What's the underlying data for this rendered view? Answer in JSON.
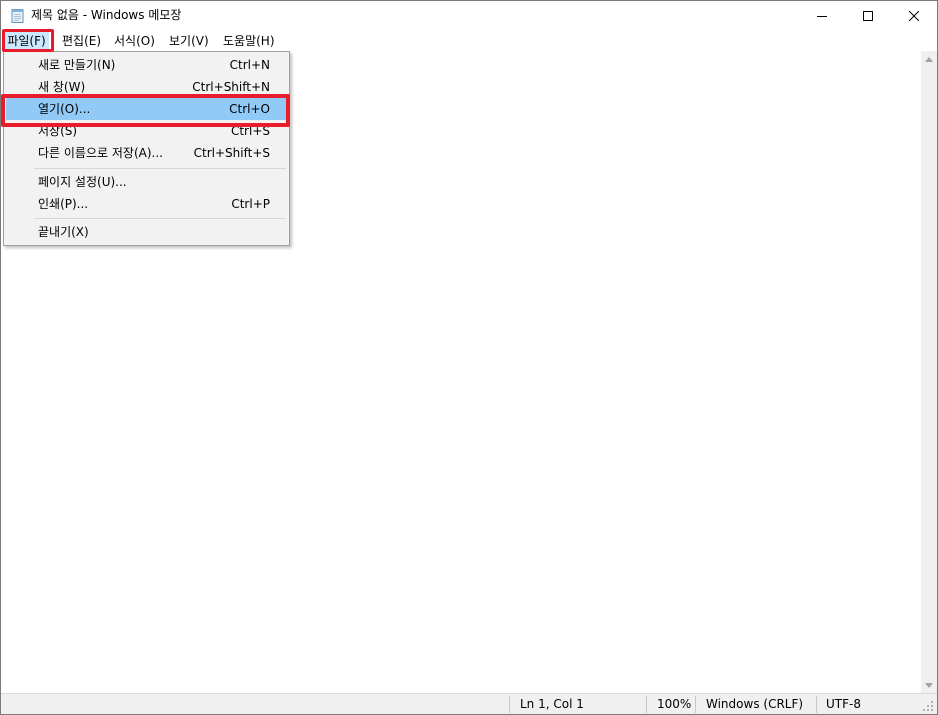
{
  "window": {
    "title": "제목 없음 - Windows 메모장",
    "icon": "notepad-icon"
  },
  "menubar": {
    "file": "파일(F)",
    "edit": "편집(E)",
    "format": "서식(O)",
    "view": "보기(V)",
    "help": "도움말(H)"
  },
  "file_menu": {
    "items": [
      {
        "label": "새로 만들기(N)",
        "shortcut": "Ctrl+N"
      },
      {
        "label": "새 창(W)",
        "shortcut": "Ctrl+Shift+N"
      },
      {
        "label": "열기(O)...",
        "shortcut": "Ctrl+O"
      },
      {
        "label": "저장(S)",
        "shortcut": "Ctrl+S"
      },
      {
        "label": "다른 이름으로 저장(A)...",
        "shortcut": "Ctrl+Shift+S"
      },
      {
        "label": "페이지 설정(U)...",
        "shortcut": ""
      },
      {
        "label": "인쇄(P)...",
        "shortcut": "Ctrl+P"
      },
      {
        "label": "끝내기(X)",
        "shortcut": ""
      }
    ],
    "selected_index": 2
  },
  "statusbar": {
    "position": "Ln 1, Col 1",
    "zoom": "100%",
    "line_ending": "Windows (CRLF)",
    "encoding": "UTF-8"
  },
  "colors": {
    "highlight_box": "#e81c2b",
    "selected_item": "#91c9f7",
    "menu_open": "#cce8ff"
  }
}
